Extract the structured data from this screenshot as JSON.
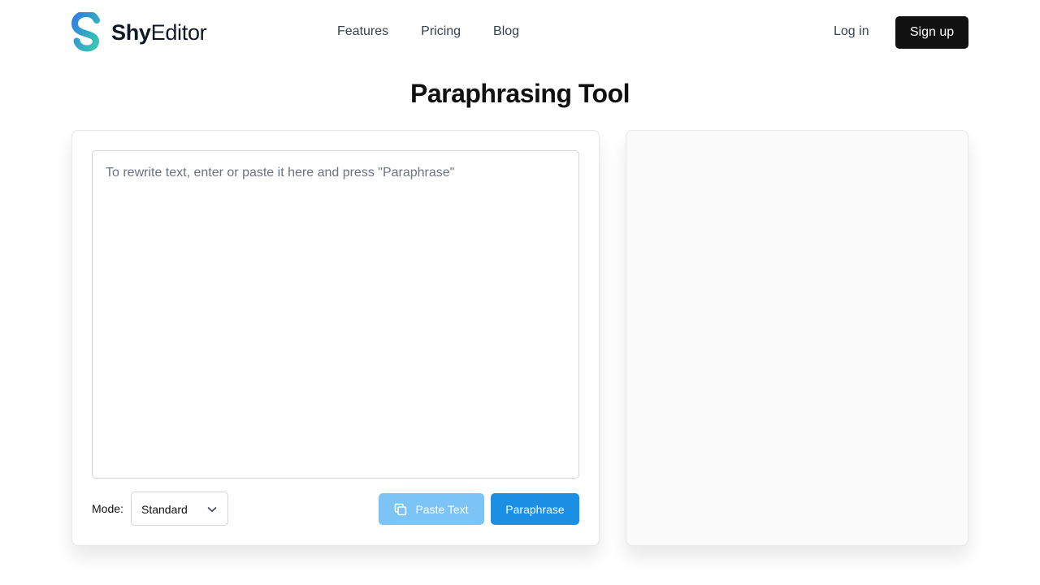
{
  "brand": {
    "name_bold": "Shy",
    "name_rest": "Editor",
    "logo_gradient": [
      "#2e7fe0",
      "#3ac9b0"
    ]
  },
  "nav": {
    "items": [
      {
        "label": "Features"
      },
      {
        "label": "Pricing"
      },
      {
        "label": "Blog"
      }
    ]
  },
  "auth": {
    "login_label": "Log in",
    "signup_label": "Sign up"
  },
  "page": {
    "title": "Paraphrasing Tool"
  },
  "editor": {
    "input_value": "",
    "placeholder": "To rewrite text, enter or paste it here and press \"Paraphrase\"",
    "mode_label": "Mode:",
    "mode_selected": "Standard",
    "paste_label": "Paste Text",
    "paraphrase_label": "Paraphrase",
    "icons": {
      "paste": "copy-icon",
      "select": "chevron-down-icon"
    }
  },
  "output": {
    "text": ""
  },
  "colors": {
    "accent": "#1a8fe3",
    "accent_light": "#7cc4f5",
    "dark": "#111111"
  }
}
